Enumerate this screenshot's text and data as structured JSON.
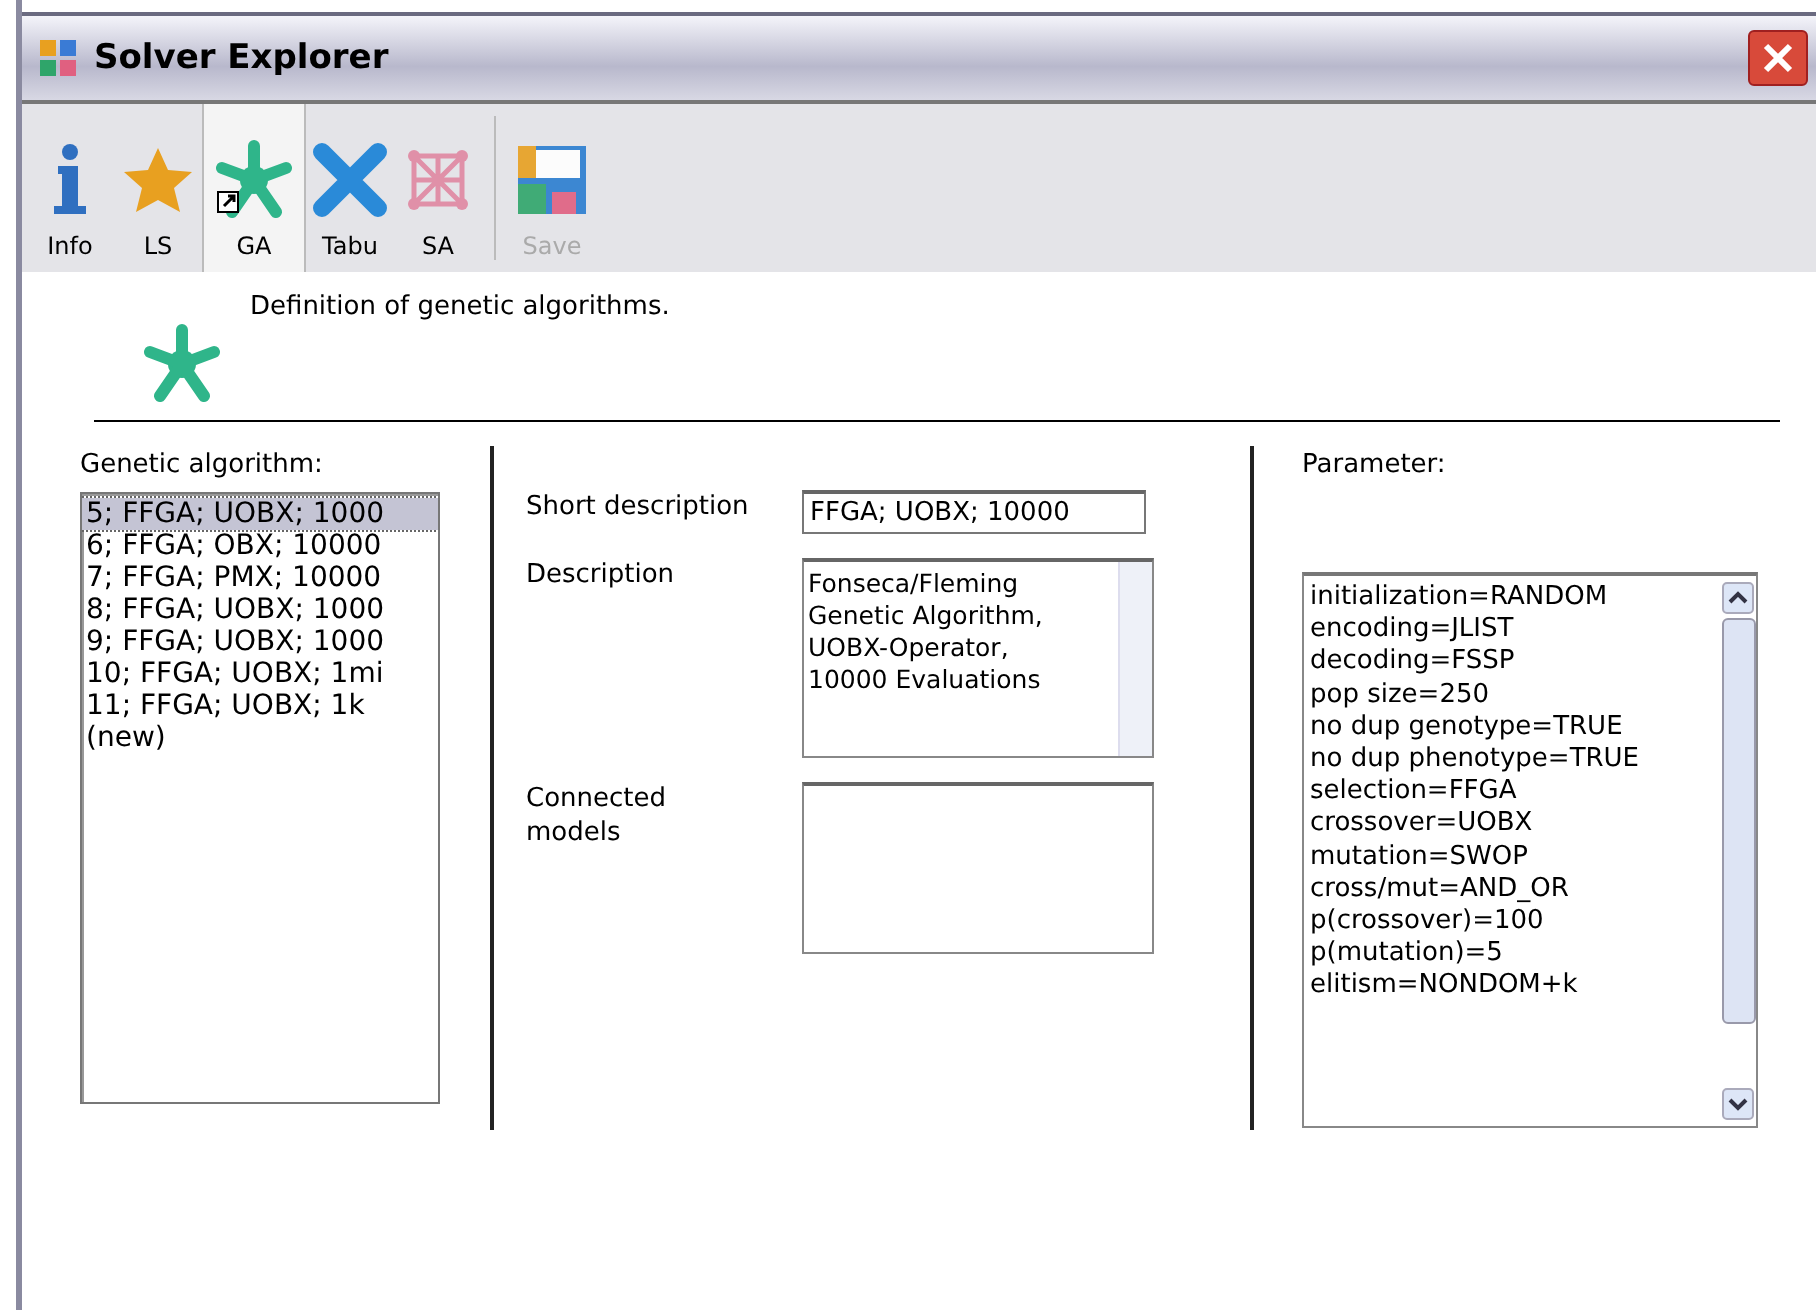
{
  "window": {
    "title": "Solver Explorer"
  },
  "toolbar": [
    {
      "kind": "info",
      "label": "Info",
      "selected": false,
      "disabled": false
    },
    {
      "kind": "ls",
      "label": "LS",
      "selected": false,
      "disabled": false
    },
    {
      "kind": "ga",
      "label": "GA",
      "selected": true,
      "disabled": false
    },
    {
      "kind": "tabu",
      "label": "Tabu",
      "selected": false,
      "disabled": false
    },
    {
      "kind": "sa",
      "label": "SA",
      "selected": false,
      "disabled": false
    },
    {
      "kind": "save",
      "label": "Save",
      "selected": false,
      "disabled": true
    }
  ],
  "header": {
    "text": "Definition of genetic algorithms."
  },
  "algorithms": {
    "label": "Genetic algorithm:",
    "items": [
      {
        "text": "5; FFGA; UOBX; 1000",
        "selected": true
      },
      {
        "text": "6; FFGA; OBX; 10000",
        "selected": false
      },
      {
        "text": "7; FFGA; PMX; 10000",
        "selected": false
      },
      {
        "text": "8; FFGA; UOBX; 1000",
        "selected": false
      },
      {
        "text": "9; FFGA; UOBX; 1000",
        "selected": false
      },
      {
        "text": "10; FFGA; UOBX; 1mi",
        "selected": false
      },
      {
        "text": "11; FFGA; UOBX; 1k",
        "selected": false
      },
      {
        "text": "(new)",
        "selected": false
      }
    ]
  },
  "form": {
    "short_label": "Short description",
    "short_value": "FFGA; UOBX; 10000",
    "description_label": "Description",
    "description_value": "Fonseca/Fleming\nGenetic Algorithm,\nUOBX-Operator,\n10000 Evaluations",
    "models_label": "Connected\nmodels"
  },
  "parameters": {
    "label": "Parameter:",
    "items": [
      "initialization=RANDOM",
      "encoding=JLIST",
      "decoding=FSSP",
      "pop size=250",
      "no dup genotype=TRUE",
      "no dup phenotype=TRUE",
      "selection=FFGA",
      "crossover=UOBX",
      "mutation=SWOP",
      "cross/mut=AND_OR",
      "p(crossover)=100",
      "p(mutation)=5",
      "elitism=NONDOM+k"
    ]
  }
}
